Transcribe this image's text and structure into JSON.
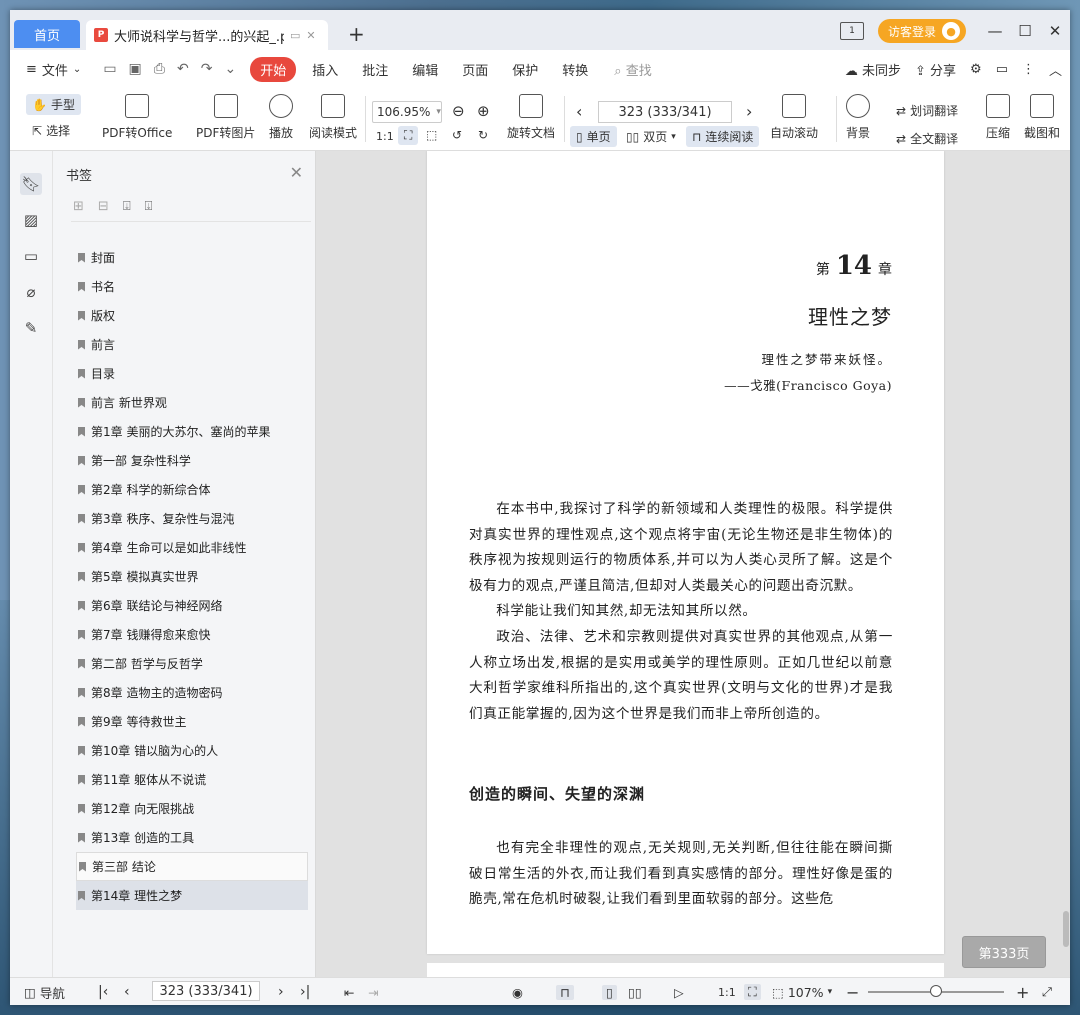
{
  "titlebar": {
    "home_tab": "首页",
    "doc_tab": "大师说科学与哲学...的兴起_.pdf",
    "add_tab": "+",
    "login": "访客登录",
    "panel_icon": "1",
    "minimize": "—",
    "maximize": "☐",
    "close": "✕"
  },
  "menubar": {
    "file": "文件",
    "start": "开始",
    "insert": "插入",
    "comment": "批注",
    "edit": "编辑",
    "page": "页面",
    "protect": "保护",
    "convert": "转换",
    "search": "查找",
    "unsynced": "未同步",
    "share": "分享"
  },
  "ribbon": {
    "hand": "手型",
    "select": "选择",
    "pdf_to_office": "PDF转Office",
    "pdf_to_image": "PDF转图片",
    "play": "播放",
    "read_mode": "阅读模式",
    "zoom": "106.95%",
    "rotate": "旋转文档",
    "page_input": "323 (333/341)",
    "single_page": "单页",
    "double_page": "双页",
    "continuous": "连续阅读",
    "auto_scroll": "自动滚动",
    "background": "背景",
    "word_translate": "划词翻译",
    "full_translate": "全文翻译",
    "compress": "压缩",
    "screenshot": "截图和"
  },
  "bookmarks": {
    "title": "书签",
    "items": [
      "封面",
      "书名",
      "版权",
      "前言",
      "目录",
      "前言  新世界观",
      "第1章  美丽的大苏尔、塞尚的苹果",
      "第一部  复杂性科学",
      "第2章  科学的新综合体",
      "第3章  秩序、复杂性与混沌",
      "第4章  生命可以是如此非线性",
      "第5章  模拟真实世界",
      "第6章  联结论与神经网络",
      "第7章  钱赚得愈来愈快",
      "第二部  哲学与反哲学",
      "第8章  造物主的造物密码",
      "第9章  等待救世主",
      "第10章  错以脑为心的人",
      "第11章  躯体从不说谎",
      "第12章  向无限挑战",
      "第13章  创造的工具",
      "第三部  结论",
      "第14章  理性之梦"
    ]
  },
  "page": {
    "chapter_prefix": "第",
    "chapter_number": "14",
    "chapter_suffix": "章",
    "chapter_title": "理性之梦",
    "epigraph": "理性之梦带来妖怪。",
    "epigraph_author": "——戈雅(Francisco Goya)",
    "p1": "在本书中,我探讨了科学的新领域和人类理性的极限。科学提供对真实世界的理性观点,这个观点将宇宙(无论生物还是非生物体)的秩序视为按规则运行的物质体系,并可以为人类心灵所了解。这是个极有力的观点,严谨且简洁,但却对人类最关心的问题出奇沉默。",
    "p2": "科学能让我们知其然,却无法知其所以然。",
    "p3": "政治、法律、艺术和宗教则提供对真实世界的其他观点,从第一人称立场出发,根据的是实用或美学的理性原则。正如几世纪以前意大利哲学家维科所指出的,这个真实世界(文明与文化的世界)才是我们真正能掌握的,因为这个世界是我们而非上帝所创造的。",
    "section_title": "创造的瞬间、失望的深渊",
    "p4": "也有完全非理性的观点,无关规则,无关判断,但往往能在瞬间撕破日常生活的外衣,而让我们看到真实感情的部分。理性好像是蛋的脆壳,常在危机时破裂,让我们看到里面软弱的部分。这些危",
    "page_badge": "第333页"
  },
  "statusbar": {
    "nav": "导航",
    "page_input": "323 (333/341)",
    "zoom": "107%"
  }
}
